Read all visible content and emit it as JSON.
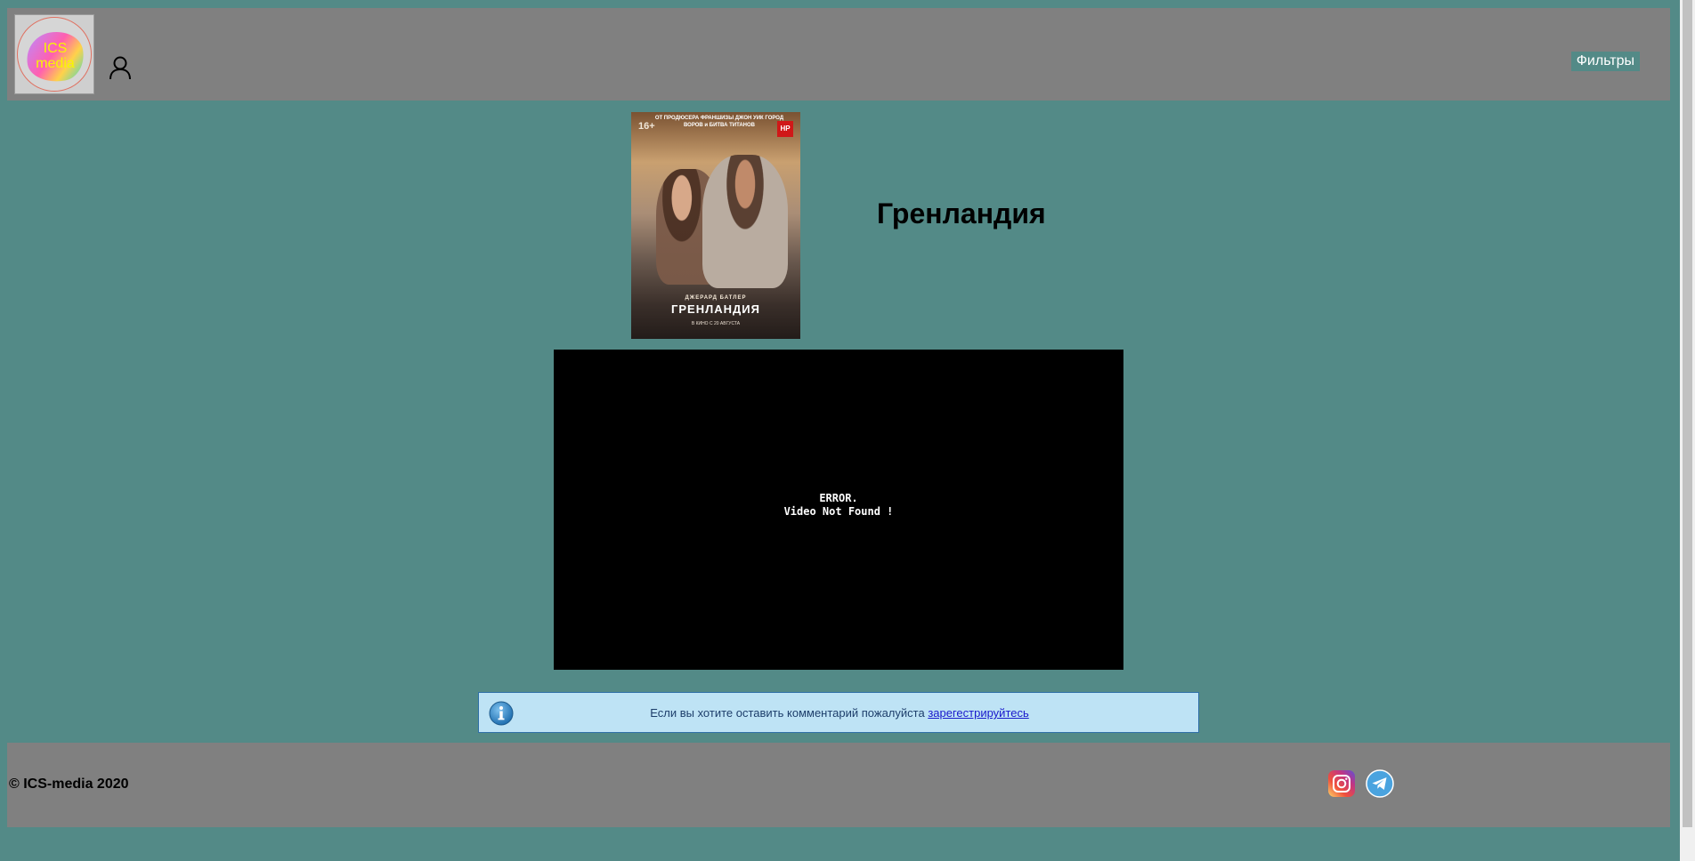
{
  "header": {
    "logo_text_line1": "ICS",
    "logo_text_line2": "media",
    "user_icon": "user-icon",
    "filters_label": "Фильтры"
  },
  "movie": {
    "title": "Гренландия",
    "poster": {
      "rating": "16+",
      "topline": "ОТ ПРОДЮСЕРА ФРАНШИЗЫ ДЖОН УИК ГОРОД ВОРОВ и БИТВА ТИТАНОВ",
      "actor": "ДЖЕРАРД БАТЛЕР",
      "name": "ГРЕНЛАНДИЯ",
      "release": "В КИНО С 20 АВГУСТА"
    }
  },
  "video": {
    "error_line1": "ERROR.",
    "error_line2": "Video Not Found !"
  },
  "info": {
    "icon": "info-icon",
    "text": "Если вы хотите оставить комментарий пожалуйста ",
    "link_text": "зарегестрируйтесь"
  },
  "footer": {
    "copyright": "© ICS-media 2020",
    "social_icons": [
      "instagram-icon",
      "telegram-icon"
    ]
  },
  "colors": {
    "page_background": "#538a87",
    "bar_background": "#808080",
    "info_background": "#bee3f5",
    "info_border": "#2f70a8"
  }
}
